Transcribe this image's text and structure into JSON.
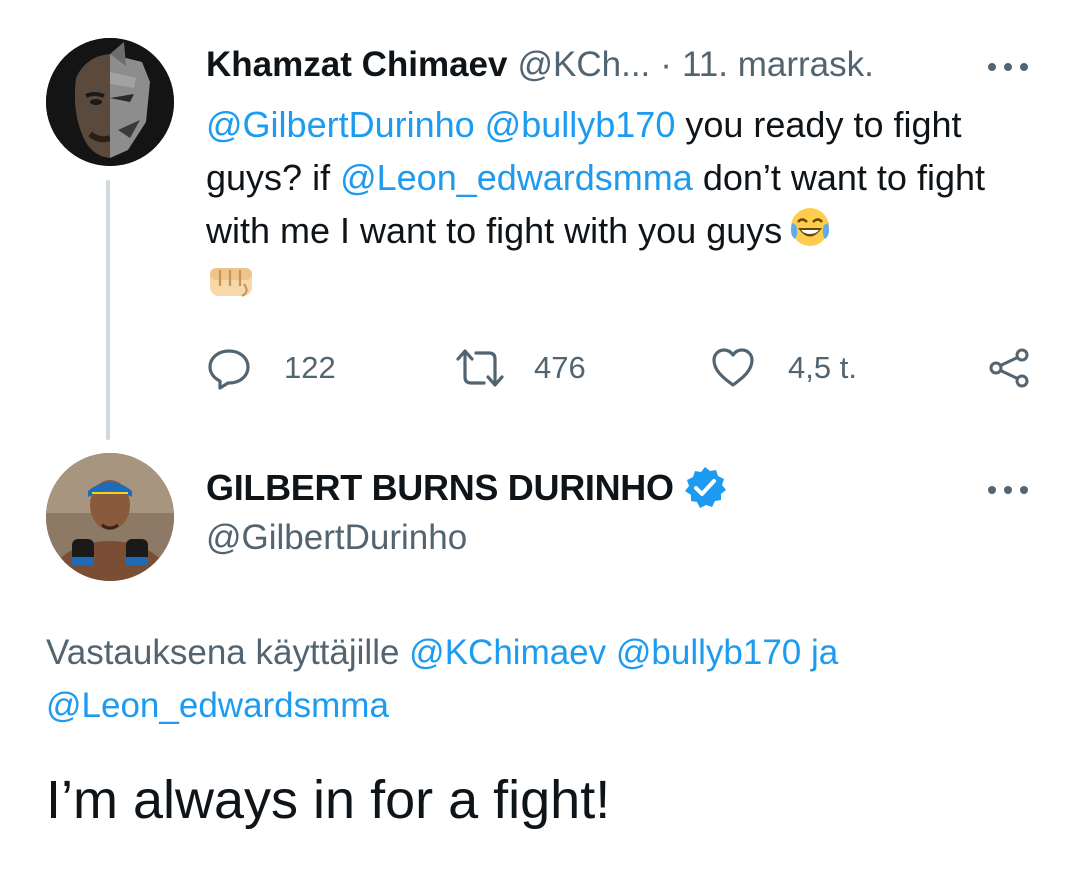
{
  "thread": {
    "tweet1": {
      "author_name": "Khamzat Chimaev",
      "author_handle": "@KCh...",
      "separator": "·",
      "date": "11. marrask.",
      "text_parts": {
        "m1": "@GilbertDurinho",
        "m2": "@bullyb170",
        "t1": " you ready to fight guys? if ",
        "m3": "@Leon_edwardsmma",
        "t2": " don’t want to fight with me I want to fight with you guys"
      },
      "emojis": [
        "face-with-tears-of-joy",
        "oncoming-fist"
      ],
      "actions": {
        "replies": "122",
        "retweets": "476",
        "likes": "4,5 t."
      }
    },
    "tweet2": {
      "author_name": "GILBERT BURNS DURINHO",
      "verified": true,
      "author_handle": "@GilbertDurinho",
      "replying_parts": {
        "prefix": "Vastauksena käyttäjille ",
        "m1": "@KChimaev",
        "m2": "@bullyb170",
        "conj": "ja",
        "m3": "@Leon_edwardsmma"
      },
      "text": "I’m always in for a fight!"
    }
  },
  "colors": {
    "link": "#1d9bf0",
    "secondary": "#536471",
    "primary": "#0f1419",
    "thread_line": "#cfd9de",
    "verified": "#1d9bf0"
  }
}
